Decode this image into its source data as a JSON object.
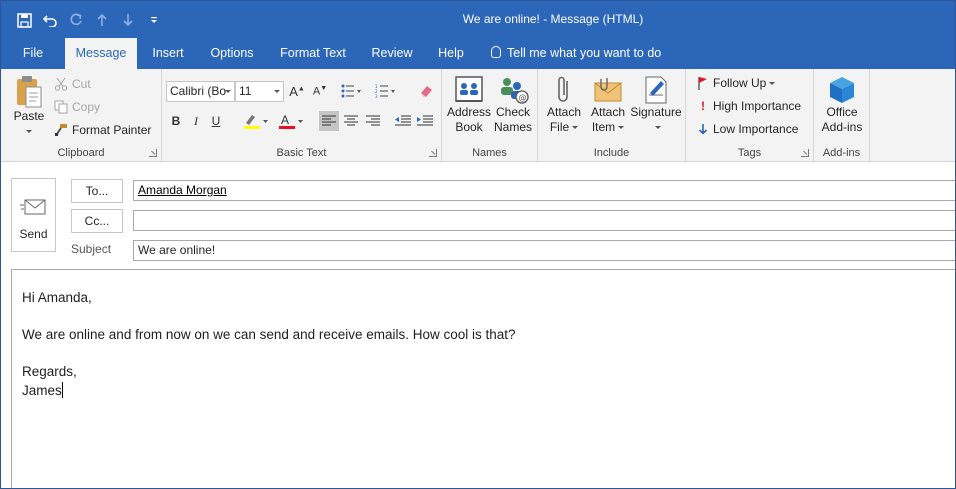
{
  "window": {
    "title": "We are online!  -  Message (HTML)"
  },
  "quick_access": {
    "save_icon": "save-icon",
    "undo_icon": "undo-icon",
    "redo_icon": "redo-icon",
    "up_icon": "arrow-up-icon",
    "down_icon": "arrow-down-icon",
    "customize_icon": "customize-qat-icon"
  },
  "tabs": [
    {
      "label": "File"
    },
    {
      "label": "Message"
    },
    {
      "label": "Insert"
    },
    {
      "label": "Options"
    },
    {
      "label": "Format Text"
    },
    {
      "label": "Review"
    },
    {
      "label": "Help"
    }
  ],
  "tell_me": "Tell me what you want to do",
  "ribbon": {
    "clipboard": {
      "label": "Clipboard",
      "paste": "Paste",
      "cut": "Cut",
      "copy": "Copy",
      "format_painter": "Format Painter"
    },
    "basic_text": {
      "label": "Basic Text",
      "font_name": "Calibri (Bo",
      "font_size": "11",
      "bold": "B",
      "italic": "I",
      "underline": "U",
      "highlight_color": "#ffff00",
      "font_color": "#e81123"
    },
    "names": {
      "label": "Names",
      "address_book_1": "Address",
      "address_book_2": "Book",
      "check_names_1": "Check",
      "check_names_2": "Names"
    },
    "include": {
      "label": "Include",
      "attach_file_1": "Attach",
      "attach_file_2": "File",
      "attach_item_1": "Attach",
      "attach_item_2": "Item",
      "signature": "Signature"
    },
    "tags": {
      "label": "Tags",
      "follow_up": "Follow Up",
      "high_importance": "High Importance",
      "low_importance": "Low Importance"
    },
    "addins": {
      "label": "Add-ins",
      "office_1": "Office",
      "office_2": "Add-ins"
    }
  },
  "compose": {
    "send": "Send",
    "to_label": "To...",
    "cc_label": "Cc...",
    "subject_label": "Subject",
    "to_value": "Amanda Morgan",
    "cc_value": "",
    "subject_value": "We are online!"
  },
  "message": {
    "greeting": "Hi Amanda,",
    "line1": "We are online and from now on we can send and receive emails. How cool is that?",
    "closing": "Regards,",
    "signature": "James"
  },
  "colors": {
    "accent": "#2b66b8",
    "ribbon_bg": "#f3f3f3"
  }
}
